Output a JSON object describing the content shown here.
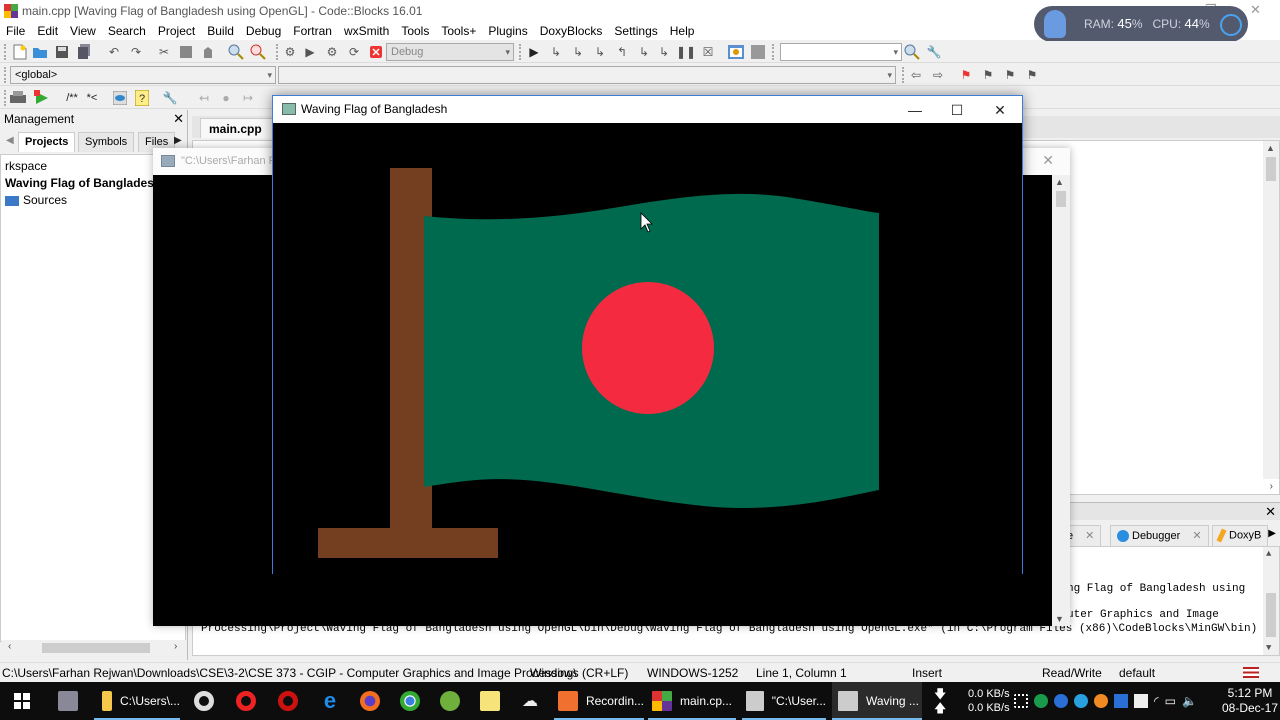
{
  "window": {
    "title": "main.cpp [Waving Flag of Bangladesh using OpenGL] - Code::Blocks 16.01"
  },
  "menu": [
    "File",
    "Edit",
    "View",
    "Search",
    "Project",
    "Build",
    "Debug",
    "Fortran",
    "wxSmith",
    "Tools",
    "Tools+",
    "Plugins",
    "DoxyBlocks",
    "Settings",
    "Help"
  ],
  "toolbar": {
    "build_target": "Debug",
    "scope": "<global>",
    "search_combo_value": "",
    "doxy_comment": "/**",
    "doxy_line": "*<"
  },
  "overlay": {
    "ram_label": "RAM:",
    "ram_value": "45",
    "cpu_label": "CPU:",
    "cpu_value": "44",
    "percent": "%"
  },
  "management": {
    "title": "Management",
    "tabs": [
      "Projects",
      "Symbols",
      "Files"
    ],
    "active_tab": "Projects",
    "tree": [
      "rkspace",
      "Waving Flag of Bangladesh u",
      "Sources"
    ]
  },
  "editor": {
    "tab_label": "main.cpp"
  },
  "console_window": {
    "title": "\"C:\\Users\\Farhan R"
  },
  "gl_window": {
    "title": "Waving Flag of Bangladesh",
    "flag_green": "#006a4e",
    "flag_red": "#f42a41",
    "pole_brown": "#733f20"
  },
  "logs": {
    "tabs": [
      "e",
      "Debugger",
      "DoxyB"
    ],
    "lines": [
      "ng Flag of Bangladesh using",
      "uter Graphics and Image",
      "Processing\\Project\\Waving Flag of Bangladesh using OpenGL\\bin\\Debug\\Waving Flag of Bangladesh using OpenGL.exe\"  (in C:\\Program Files (x86)\\CodeBlocks\\MinGW\\bin)"
    ]
  },
  "statusbar": {
    "path": "C:\\Users\\Farhan Rejwan\\Downloads\\CSE\\3-2\\CSE 373 - CGIP - Computer Graphics and Image Processing\\",
    "eol": "Windows (CR+LF)",
    "encoding": "WINDOWS-1252",
    "position": "Line 1, Column 1",
    "mode": "Insert",
    "access": "Read/Write",
    "lang": "default"
  },
  "taskbar": {
    "items": [
      {
        "label": "C:\\Users\\...",
        "icon": "folder-icon"
      },
      {
        "label": "Recordin...",
        "icon": "recorder-icon"
      },
      {
        "label": "main.cp...",
        "icon": "codeblocks-icon"
      },
      {
        "label": "\"C:\\User...",
        "icon": "console-icon"
      },
      {
        "label": "Waving ...",
        "icon": "window-icon"
      }
    ],
    "net_down": "0.0 KB/s",
    "net_up": "0.0 KB/s",
    "time": "5:12 PM",
    "date": "08-Dec-17"
  }
}
